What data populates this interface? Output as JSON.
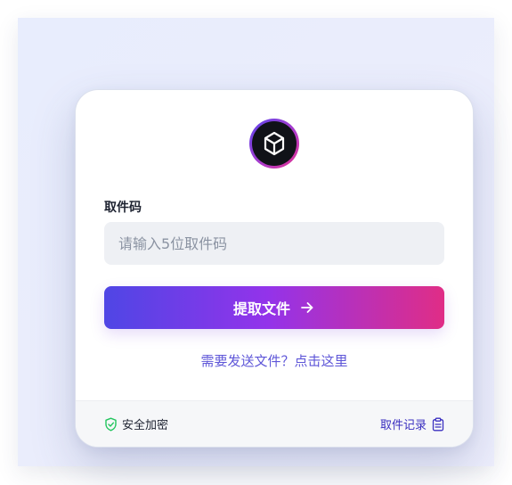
{
  "app": {
    "field_label": "取件码",
    "code_placeholder": "请输入5位取件码",
    "code_value": "",
    "submit_label": "提取文件",
    "send_link_label": "需要发送文件？点击这里"
  },
  "footer": {
    "secure_label": "安全加密",
    "history_label": "取件记录"
  },
  "icons": {
    "logo": "cube-icon",
    "submit": "arrow-right-icon",
    "secure": "shield-check-icon",
    "history": "clipboard-icon"
  },
  "colors": {
    "accent_start": "#4f46e5",
    "accent_mid": "#9333ea",
    "accent_end": "#e02d86",
    "link": "#5e56d8",
    "secure_green": "#22c55e",
    "history_link": "#3a2fc0"
  }
}
